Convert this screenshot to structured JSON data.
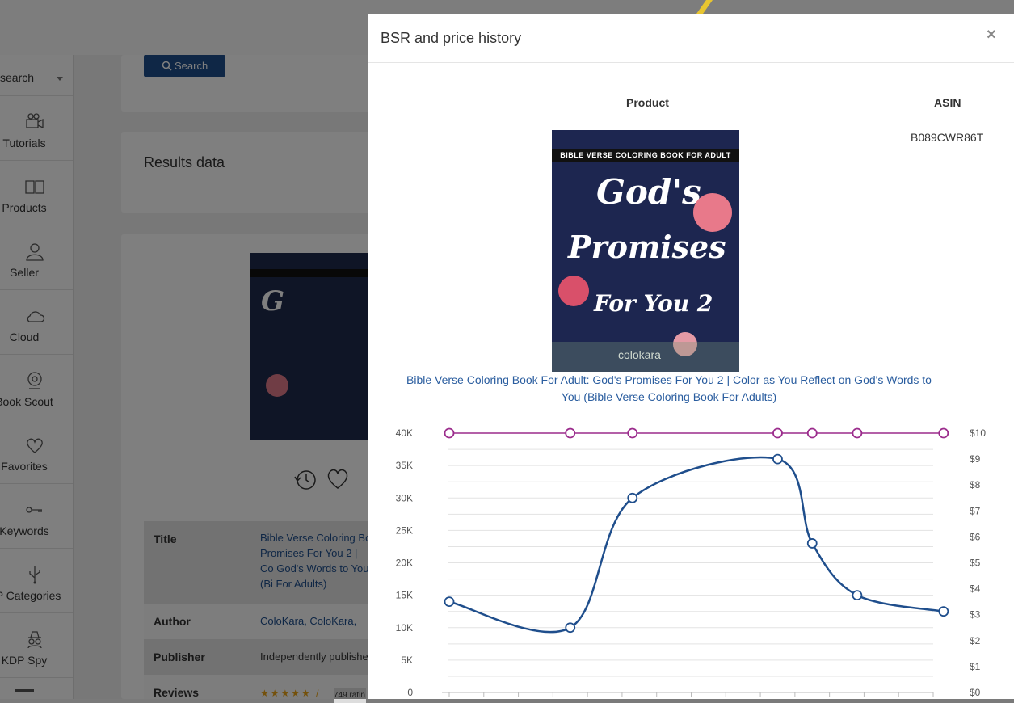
{
  "background": {
    "sidebar": {
      "search_label": "search",
      "items": [
        {
          "label": "Tutorials",
          "icon": "camera-icon"
        },
        {
          "label": "Products",
          "icon": "book-icon"
        },
        {
          "label": "Seller",
          "icon": "user-icon"
        },
        {
          "label": "Cloud",
          "icon": "cloud-icon"
        },
        {
          "label": "Book Scout",
          "icon": "webcam-icon"
        },
        {
          "label": "Favorites",
          "icon": "heart-icon"
        },
        {
          "label": "Keywords",
          "icon": "key-icon"
        },
        {
          "label": "DP Categories",
          "icon": "usb-icon"
        },
        {
          "label": "KDP Spy",
          "icon": "spy-icon"
        }
      ]
    },
    "search_button": "Search",
    "results_title": "Results data",
    "table": [
      {
        "key": "Title",
        "value": "Bible Verse Coloring Bo Promises For You 2 | Co God's Words to You (Bi For Adults)"
      },
      {
        "key": "Author",
        "value": "ColoKara, ColoKara,"
      },
      {
        "key": "Publisher",
        "value": "Independently publishe"
      },
      {
        "key": "Reviews",
        "value": "749 ratin"
      }
    ]
  },
  "modal": {
    "title": "BSR and price history",
    "close_label": "×",
    "columns": {
      "product": "Product",
      "asin": "ASIN"
    },
    "asin": "B089CWR86T",
    "cover": {
      "banner": "BIBLE VERSE COLORING BOOK FOR ADULT",
      "line1": "God's",
      "line2": "Promises",
      "line3": "For You 2",
      "brand": "colokara"
    },
    "product_title": "Bible Verse Coloring Book For Adult: God's Promises For You 2 | Color as You Reflect on God's Words to You (Bible Verse Coloring Book For Adults)"
  },
  "chart_data": {
    "type": "line",
    "yleft_ticks": [
      "0",
      "5K",
      "10K",
      "15K",
      "20K",
      "25K",
      "30K",
      "35K",
      "40K"
    ],
    "yright_ticks": [
      "$0",
      "$1",
      "$2",
      "$3",
      "$4",
      "$5",
      "$6",
      "$7",
      "$8",
      "$9",
      "$10"
    ],
    "ylim_left": [
      0,
      40000
    ],
    "ylim_right": [
      0,
      10
    ],
    "grid": true,
    "series": [
      {
        "axis": "left",
        "color": "#1f4e8c",
        "x_index": [
          0,
          3.5,
          5.3,
          9.5,
          10.5,
          11.8,
          14.3
        ],
        "values": [
          14000,
          10000,
          30000,
          36000,
          23000,
          15000,
          12500
        ]
      },
      {
        "axis": "right",
        "color": "#9b2c8c",
        "x_index": [
          0,
          3.5,
          5.3,
          9.5,
          10.5,
          11.8,
          14.3
        ],
        "values": [
          10,
          10,
          10,
          10,
          10,
          10,
          10
        ]
      }
    ],
    "x_count": 15
  }
}
